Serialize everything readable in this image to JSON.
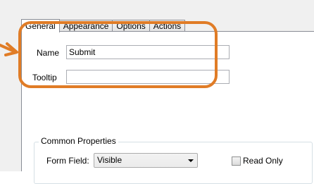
{
  "tabs": [
    {
      "label": "General",
      "active": true
    },
    {
      "label": "Appearance",
      "active": false
    },
    {
      "label": "Options",
      "active": false
    },
    {
      "label": "Actions",
      "active": false
    }
  ],
  "fields": {
    "name": {
      "label": "Name",
      "value": "Submit"
    },
    "tooltip": {
      "label": "Tooltip",
      "value": ""
    }
  },
  "common_properties": {
    "title": "Common Properties",
    "form_field_label": "Form Field:",
    "form_field_value": "Visible",
    "read_only_label": "Read Only",
    "read_only_checked": false
  },
  "annotation": {
    "color": "#e07c26",
    "icon": "arrow-right-icon"
  }
}
